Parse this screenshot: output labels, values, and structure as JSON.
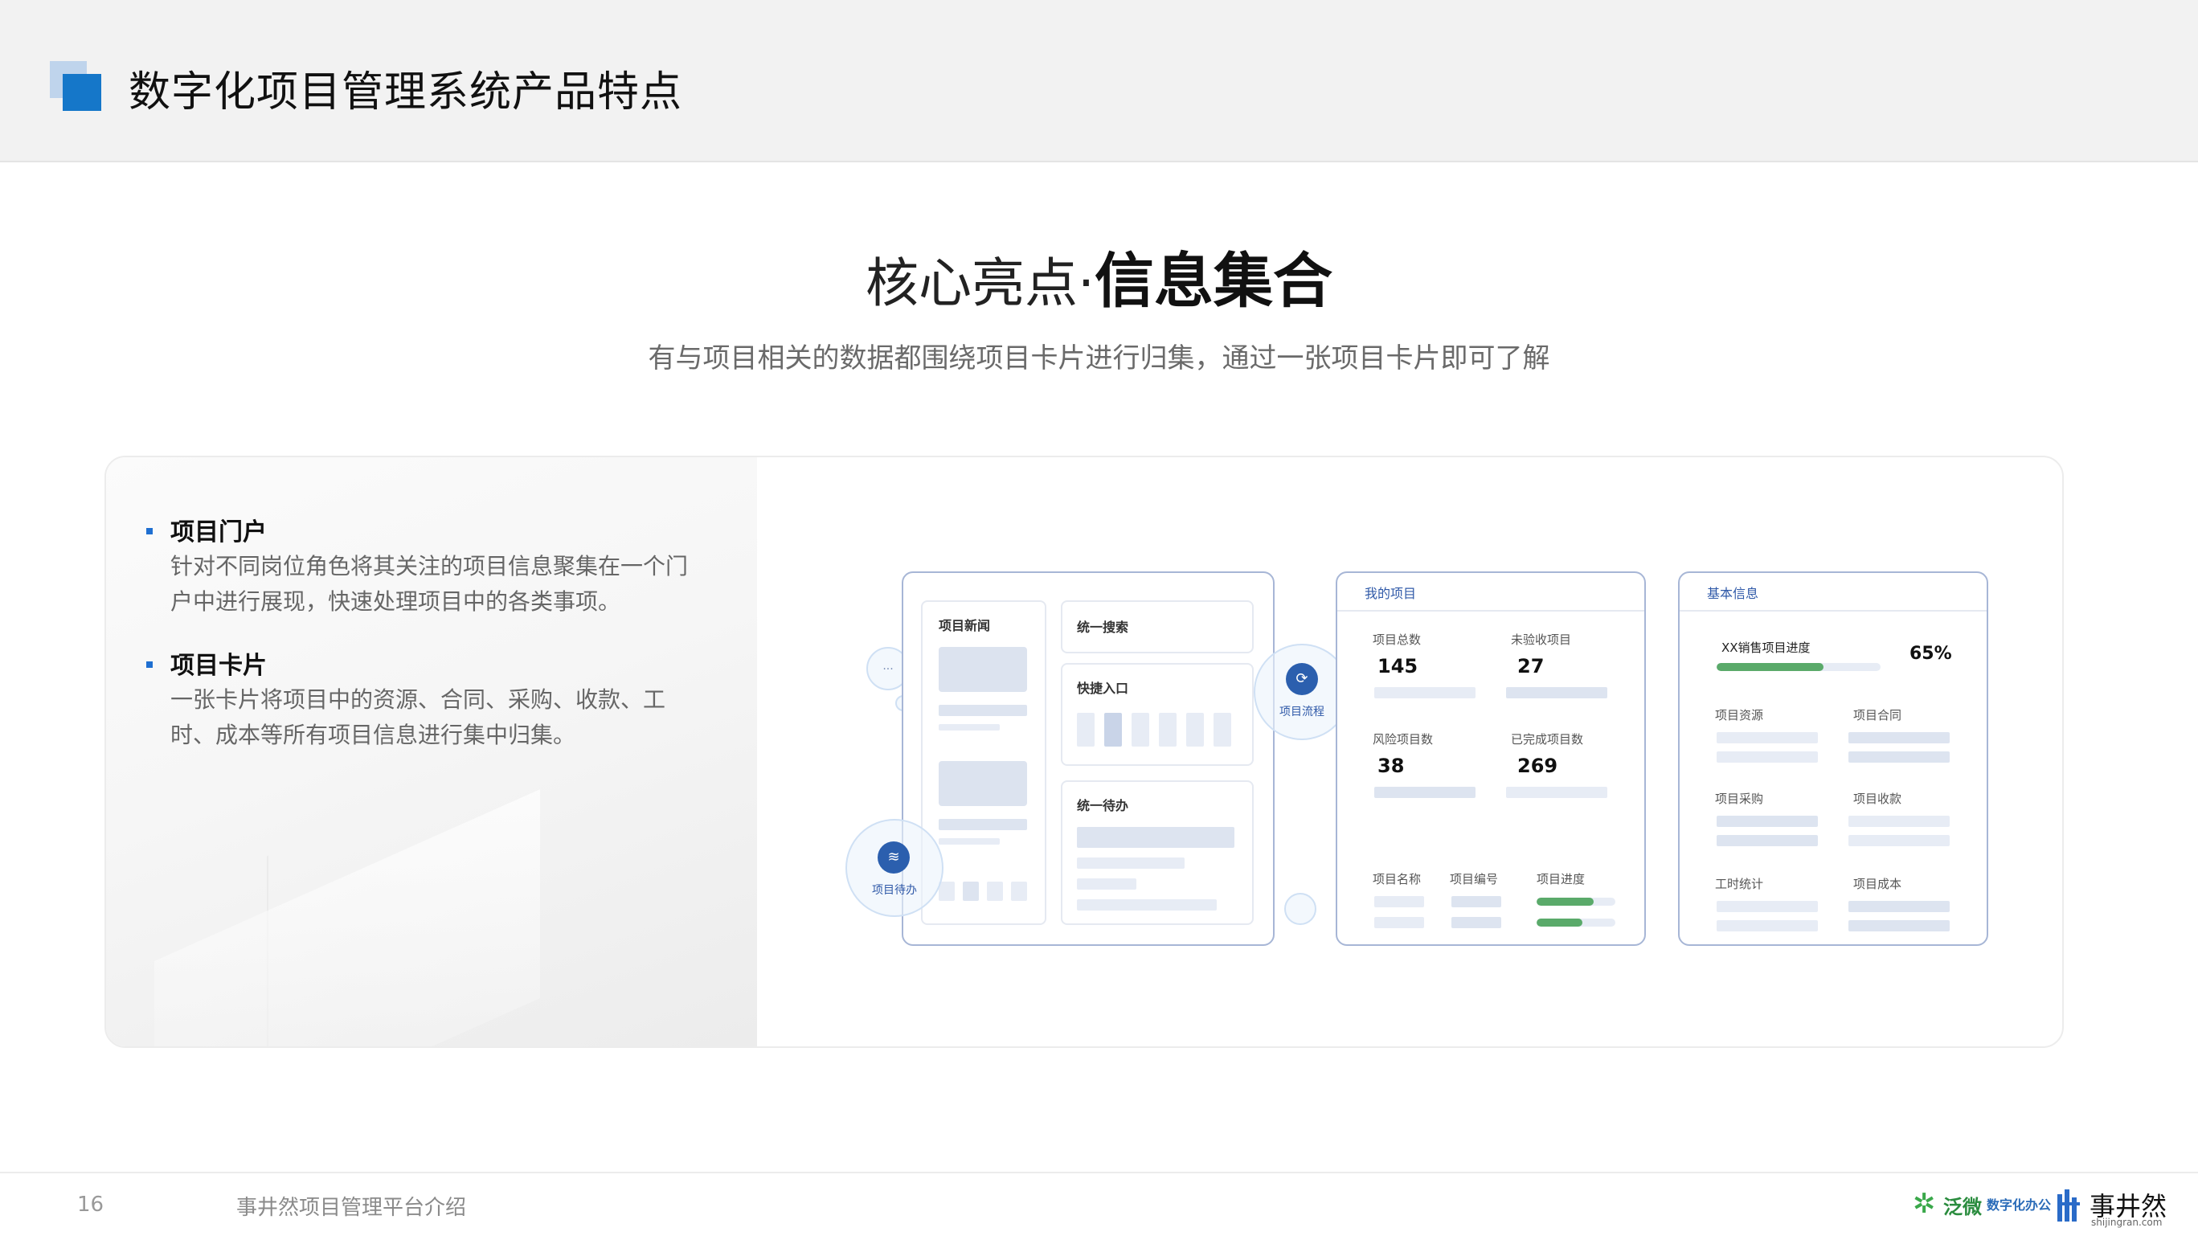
{
  "header": {
    "title": "数字化项目管理系统产品特点"
  },
  "hero": {
    "title_prefix": "核心亮点·",
    "title_strong": "信息集合",
    "subtitle": "有与项目相关的数据都围绕项目卡片进行归集，通过一张项目卡片即可了解"
  },
  "features": [
    {
      "title": "项目门户",
      "desc": "针对不同岗位角色将其关注的项目信息聚集在一个门户中进行展现，快速处理项目中的各类事项。"
    },
    {
      "title": "项目卡片",
      "desc": "一张卡片将项目中的资源、合同、采购、收款、工时、成本等所有项目信息进行集中归集。"
    }
  ],
  "illustration": {
    "portal": {
      "news": "项目新闻",
      "search": "统一搜索",
      "quick": "快捷入口",
      "todo": "统一待办"
    },
    "bubbles": {
      "flow": "项目流程",
      "todo": "项目待办",
      "more": "..."
    },
    "my_projects": {
      "title": "我的项目",
      "stats": [
        {
          "label": "项目总数",
          "value": "145"
        },
        {
          "label": "未验收项目",
          "value": "27"
        },
        {
          "label": "风险项目数",
          "value": "38"
        },
        {
          "label": "已完成项目数",
          "value": "269"
        }
      ],
      "columns": [
        "项目名称",
        "项目编号",
        "项目进度"
      ],
      "progress": [
        0.72,
        0.58
      ]
    },
    "basic_info": {
      "title": "基本信息",
      "progress_label": "XX销售项目进度",
      "progress_value": "65%",
      "progress_fraction": 0.65,
      "fields": [
        "项目资源",
        "项目合同",
        "项目采购",
        "项目收款",
        "工时统计",
        "项目成本"
      ]
    }
  },
  "footer": {
    "page": "16",
    "text": "事井然项目管理平台介绍",
    "brand_weaver": "泛微",
    "brand_weaver_tag": "数字化办公",
    "brand_sjr": "事井然",
    "brand_sjr_domain": "shijingran.com"
  },
  "colors": {
    "accent": "#1577c9",
    "link": "#2f59a8",
    "progress": "#5aaa6a"
  }
}
